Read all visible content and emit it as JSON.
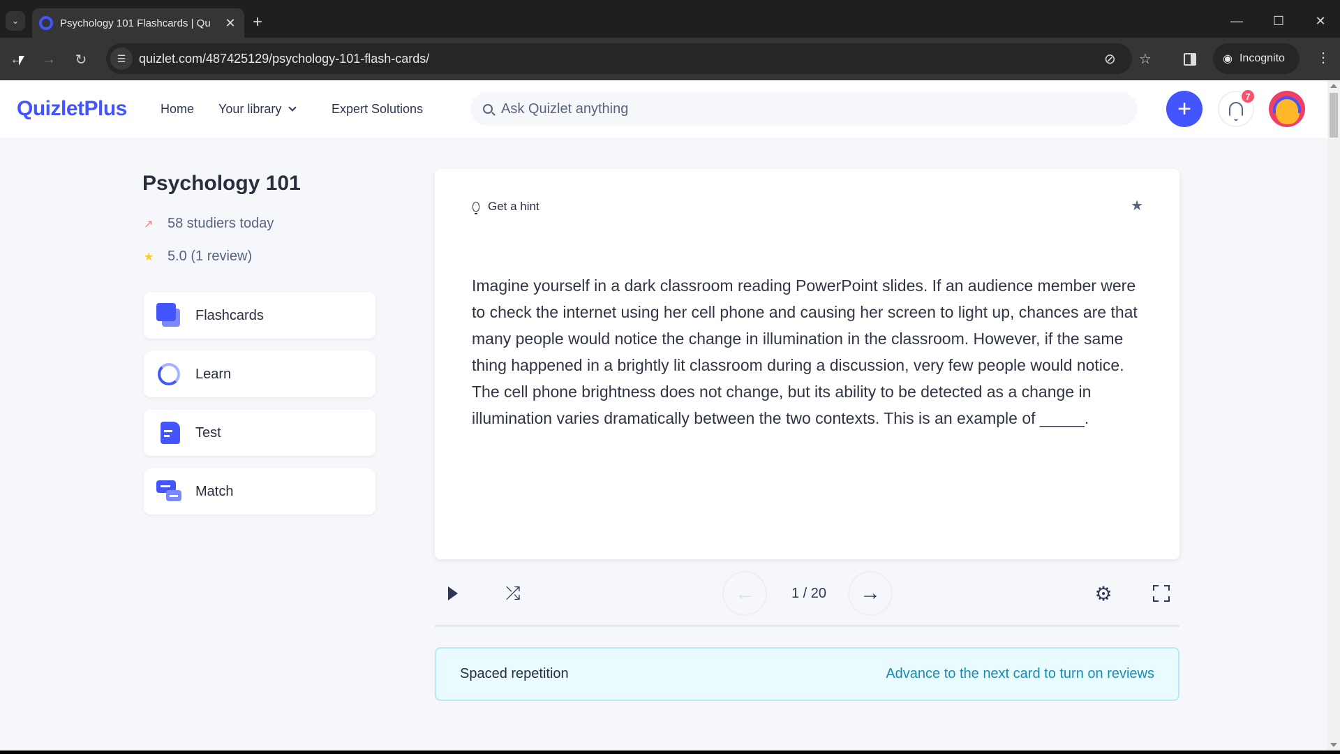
{
  "browser": {
    "tab_title": "Psychology 101 Flashcards | Qu",
    "url": "quizlet.com/487425129/psychology-101-flash-cards/",
    "incognito_label": "Incognito"
  },
  "header": {
    "logo": "QuizletPlus",
    "nav": [
      {
        "label": "Home"
      },
      {
        "label": "Your library"
      },
      {
        "label": "Expert Solutions"
      }
    ],
    "search_placeholder": "Ask Quizlet anything",
    "create_symbol": "+",
    "notification_count": "7"
  },
  "sidebar": {
    "set_title": "Psychology 101",
    "studiers": "58 studiers today",
    "rating": "5.0 (1 review)",
    "modes": [
      {
        "label": "Flashcards"
      },
      {
        "label": "Learn"
      },
      {
        "label": "Test"
      },
      {
        "label": "Match"
      }
    ]
  },
  "card": {
    "hint_label": "Get a hint",
    "term": "Imagine yourself in a dark classroom reading PowerPoint slides. If an audience member were to check the internet using her cell phone and causing her screen to light up, chances are that many people would notice the change in illumination in the classroom. However, if the same thing happened in a brightly lit classroom during a discussion, very few people would notice. The cell phone brightness does not change, but its ability to be detected as a change in illumination varies dramatically between the two contexts. This is an example of _____."
  },
  "controls": {
    "counter": "1 / 20",
    "current": 1,
    "total": 20,
    "progress_fraction": 0.0
  },
  "spaced_repetition": {
    "title": "Spaced repetition",
    "link": "Advance to the next card to turn on reviews"
  },
  "colors": {
    "brand": "#4255ff",
    "badge": "#ff4f6a",
    "info_link": "#1b8ab2"
  }
}
